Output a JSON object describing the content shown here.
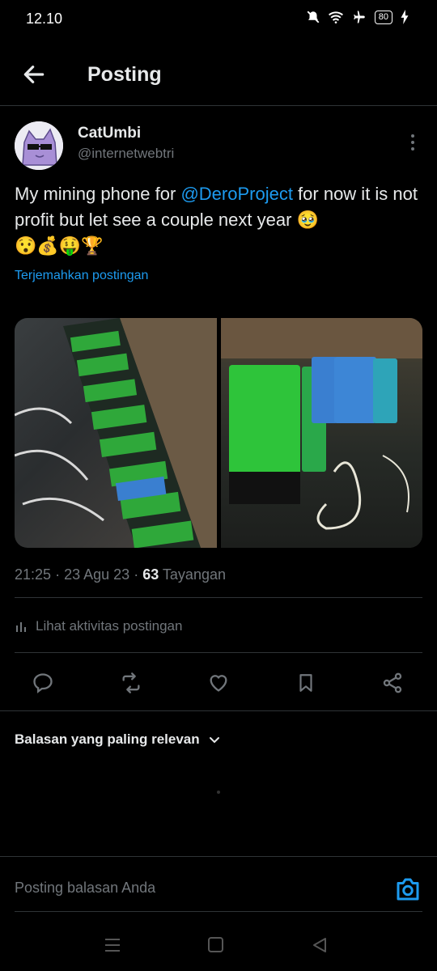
{
  "status_bar": {
    "time": "12.10",
    "battery": "80"
  },
  "header": {
    "title": "Posting"
  },
  "author": {
    "name": "CatUmbi",
    "handle": "@internetwebtri"
  },
  "tweet": {
    "text_before": "My mining phone for ",
    "mention": "@DeroProject",
    "text_after": " for now it is not profit but let see a couple next year 🥹",
    "emoji_line": "😯💰🤑🏆",
    "translate": "Terjemahkan postingan"
  },
  "meta": {
    "time": "21:25",
    "date": "23 Agu 23",
    "views_count": "63",
    "views_label": "Tayangan",
    "sep": "·"
  },
  "activity": {
    "label": "Lihat aktivitas postingan"
  },
  "replies": {
    "sort_label": "Balasan yang paling relevan"
  },
  "reply_bar": {
    "placeholder": "Posting balasan Anda"
  },
  "colors": {
    "background": "#000000",
    "accent": "#1d9bf0",
    "muted": "#71767b",
    "text": "#e7e9ea"
  },
  "icons": [
    "back-arrow-icon",
    "more-vertical-icon",
    "reply-icon",
    "repost-icon",
    "like-icon",
    "bookmark-icon",
    "share-icon",
    "camera-icon",
    "chevron-down-icon",
    "bar-chart-icon"
  ]
}
